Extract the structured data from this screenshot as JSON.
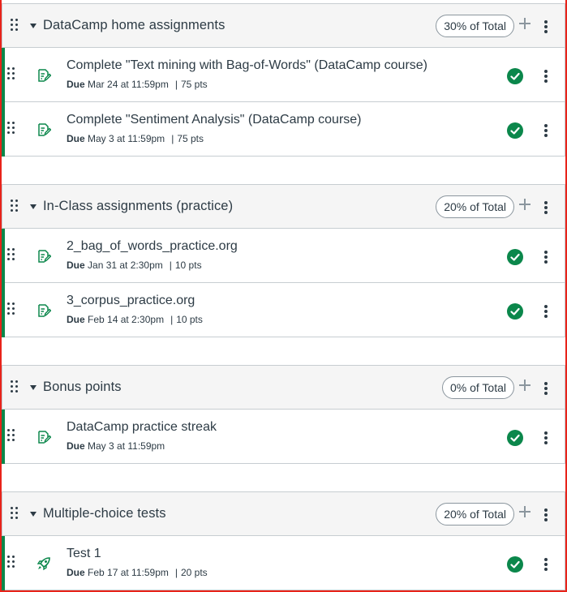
{
  "groups": [
    {
      "title": "DataCamp home assignments",
      "weight": "30% of Total",
      "items": [
        {
          "title": "Complete \"Text mining with Bag-of-Words\" (DataCamp course)",
          "due_label": "Due",
          "due": "Mar 24 at 11:59pm",
          "pts": "75 pts",
          "icon": "assignment-icon"
        },
        {
          "title": "Complete \"Sentiment Analysis\" (DataCamp course)",
          "due_label": "Due",
          "due": "May 3 at 11:59pm",
          "pts": "75 pts",
          "icon": "assignment-icon"
        }
      ]
    },
    {
      "title": "In-Class assignments (practice)",
      "weight": "20% of Total",
      "items": [
        {
          "title": "2_bag_of_words_practice.org",
          "due_label": "Due",
          "due": "Jan 31 at 2:30pm",
          "pts": "10 pts",
          "icon": "assignment-icon"
        },
        {
          "title": "3_corpus_practice.org",
          "due_label": "Due",
          "due": "Feb 14 at 2:30pm",
          "pts": "10 pts",
          "icon": "assignment-icon"
        }
      ]
    },
    {
      "title": "Bonus points",
      "weight": "0% of Total",
      "items": [
        {
          "title": "DataCamp practice streak",
          "due_label": "Due",
          "due": "May 3 at 11:59pm",
          "pts": "",
          "icon": "assignment-icon"
        }
      ]
    },
    {
      "title": "Multiple-choice tests",
      "weight": "20% of Total",
      "items": [
        {
          "title": "Test 1",
          "due_label": "Due",
          "due": "Feb 17 at 11:59pm",
          "pts": "20 pts",
          "icon": "quiz-rocket-icon"
        }
      ]
    }
  ],
  "colors": {
    "published": "#0b874b",
    "text": "#2d3b45",
    "header_bg": "#f5f5f5",
    "border": "#c7cdd1",
    "frame": "#e8231a"
  }
}
